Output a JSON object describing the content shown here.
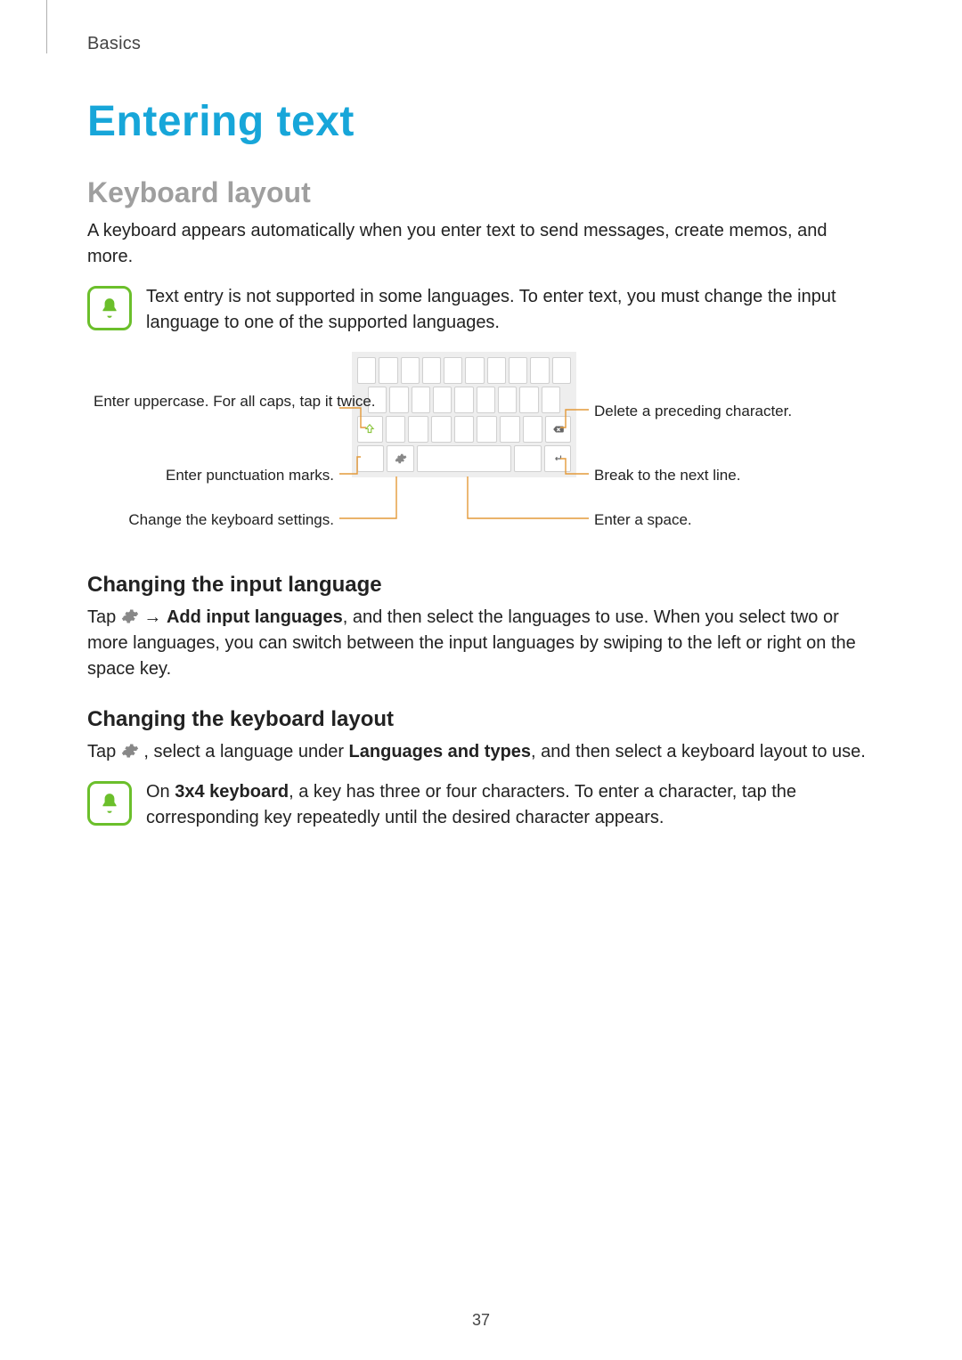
{
  "chapter": "Basics",
  "title": "Entering text",
  "section1": {
    "heading": "Keyboard layout",
    "para": "A keyboard appears automatically when you enter text to send messages, create memos, and more."
  },
  "note1": "Text entry is not supported in some languages. To enter text, you must change the input language to one of the supported languages.",
  "callouts": {
    "uppercase": "Enter uppercase. For all caps, tap it twice.",
    "punct": "Enter punctuation marks.",
    "settings": "Change the keyboard settings.",
    "delete": "Delete a preceding character.",
    "break": "Break to the next line.",
    "space": "Enter a space."
  },
  "sub1": {
    "heading": "Changing the input language",
    "before_icon": "Tap ",
    "after_icon_before_bold": " → ",
    "bold": "Add input languages",
    "after_bold": ", and then select the languages to use. When you select two or more languages, you can switch between the input languages by swiping to the left or right on the space key."
  },
  "sub2": {
    "heading": "Changing the keyboard layout",
    "before_icon": "Tap ",
    "after_icon": ", select a language under ",
    "bold": "Languages and types",
    "after_bold": ", and then select a keyboard layout to use."
  },
  "note2": {
    "before_bold1": "On ",
    "bold1": "3x4 keyboard",
    "after_bold1": ", a key has three or four characters. To enter a character, tap the corresponding key repeatedly until the desired character appears."
  },
  "page_number": "37"
}
